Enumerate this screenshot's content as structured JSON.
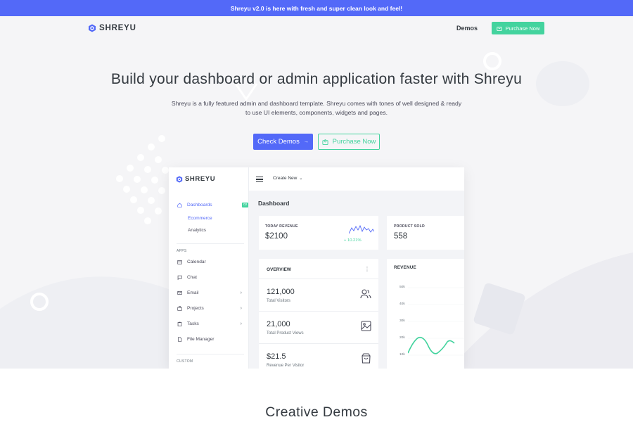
{
  "announcement": "Shreyu v2.0 is here with fresh and super clean look and feel!",
  "brand": "SHREYU",
  "nav": {
    "demos": "Demos",
    "purchase": "Purchase Now"
  },
  "hero": {
    "title": "Build your dashboard or admin application faster with Shreyu",
    "description": "Shreyu is a fully featured admin and dashboard template. Shreyu comes with tones of well designed & ready to use UI elements, components, widgets and pages.",
    "check_demos": "Check Demos",
    "check_demos_arrow": "→",
    "purchase": "Purchase Now"
  },
  "mock": {
    "create_new": "Create New",
    "sidebar": {
      "dashboards": "Dashboards",
      "dashboards_badge": "02",
      "sub_ecommerce": "Ecommerce",
      "sub_analytics": "Analytics",
      "apps_heading": "APPS",
      "items": [
        "Calendar",
        "Chat",
        "Email",
        "Projects",
        "Tasks",
        "File Manager"
      ],
      "custom_heading": "CUSTOM"
    },
    "dashboard_title": "Dashboard",
    "today_revenue": {
      "label": "TODAY REVENUE",
      "value": "$2100",
      "growth": "+ 10.21%"
    },
    "product_sold": {
      "label": "PRODUCT SOLD",
      "value": "558"
    },
    "overview": {
      "title": "OVERVIEW",
      "menu": "⋮",
      "rows": [
        {
          "value": "121,000",
          "label": "Total Visitors"
        },
        {
          "value": "21,000",
          "label": "Total Product Views"
        },
        {
          "value": "$21.5",
          "label": "Revenue Per Visitor"
        }
      ]
    },
    "revenue": {
      "title": "REVENUE",
      "ticks": [
        "50k",
        "40k",
        "30k",
        "20k",
        "10k"
      ]
    }
  },
  "creative_demos": "Creative Demos",
  "colors": {
    "primary": "#5369f8",
    "success": "#43d39e",
    "text": "#343a40"
  }
}
